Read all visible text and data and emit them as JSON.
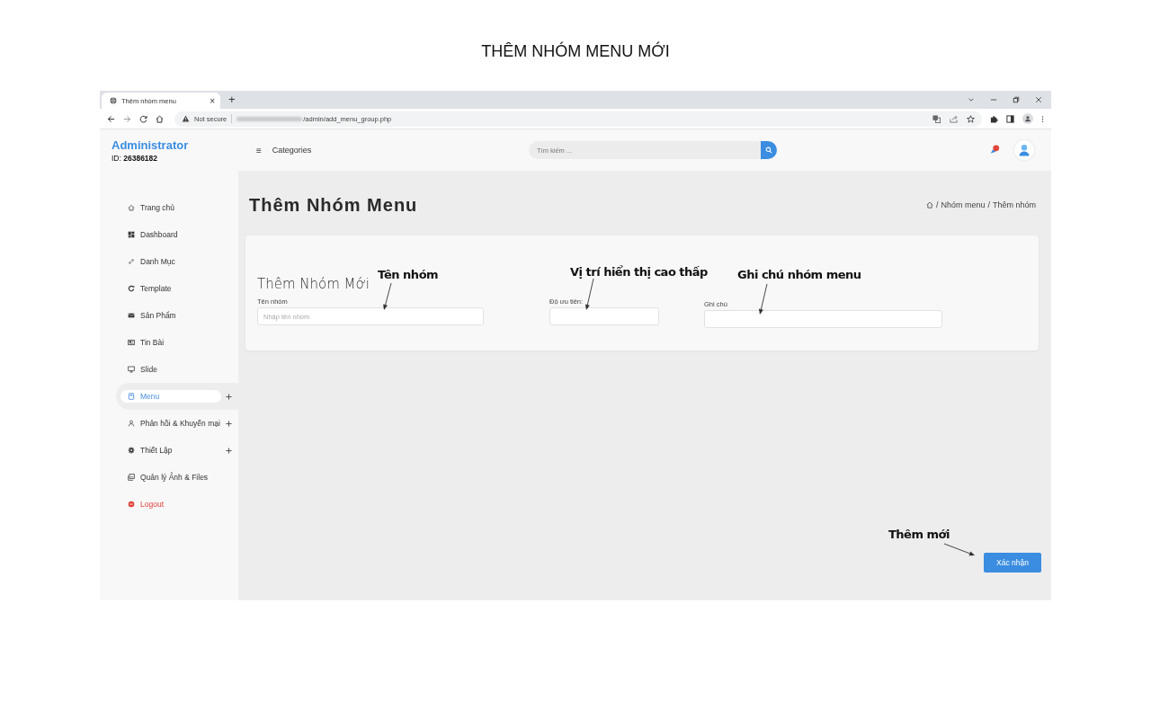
{
  "document_title": "THÊM NHÓM MENU MỚI",
  "browser": {
    "tab": {
      "title": "Thêm nhóm menu",
      "close": "×"
    },
    "new_tab": "+",
    "security": "Not secure",
    "url_path": "/admin/add_menu_group.php"
  },
  "header": {
    "brand": "Administrator",
    "id_label": "ID:",
    "id_value": "26386182",
    "menu_toggle": "≡",
    "categories": "Categories",
    "search": {
      "placeholder": "Tìm kiếm ..."
    }
  },
  "sidebar": [
    {
      "label": "Trang chủ",
      "kind": "normal",
      "selected": false,
      "expandable": false
    },
    {
      "label": "Dashboard",
      "kind": "normal",
      "selected": false,
      "expandable": false
    },
    {
      "label": "Danh Mục",
      "kind": "normal",
      "selected": false,
      "expandable": false
    },
    {
      "label": "Template",
      "kind": "normal",
      "selected": false,
      "expandable": false
    },
    {
      "label": "Sản Phẩm",
      "kind": "normal",
      "selected": false,
      "expandable": false
    },
    {
      "label": "Tin Bài",
      "kind": "normal",
      "selected": false,
      "expandable": false
    },
    {
      "label": "Slide",
      "kind": "normal",
      "selected": false,
      "expandable": false
    },
    {
      "label": "Menu",
      "kind": "normal",
      "selected": true,
      "expandable": true
    },
    {
      "label": "Phản hồi & Khuyến mại",
      "kind": "normal",
      "selected": false,
      "expandable": true
    },
    {
      "label": "Thiết Lập",
      "kind": "normal",
      "selected": false,
      "expandable": true
    },
    {
      "label": "Quản lý Ảnh & Files",
      "kind": "normal",
      "selected": false,
      "expandable": false
    },
    {
      "label": "Logout",
      "kind": "danger",
      "selected": false,
      "expandable": false
    }
  ],
  "page": {
    "title": "Thêm Nhóm Menu",
    "breadcrumb_separator": "/",
    "breadcrumb": [
      "Nhóm menu",
      "Thêm nhóm"
    ]
  },
  "form": {
    "title": "Thêm Nhóm Mới",
    "fields": [
      {
        "label": "Tên nhóm",
        "placeholder": "Nhập tên nhóm"
      },
      {
        "label": "Độ ưu tiên:"
      },
      {
        "label": "Ghi chú"
      }
    ],
    "submit": "Xác nhận"
  },
  "annotations": [
    {
      "text": "Tên nhóm"
    },
    {
      "text": "Vị trí hiển thị cao thấp"
    },
    {
      "text": "Ghi chú nhóm menu"
    },
    {
      "text": "Thêm mới"
    }
  ]
}
